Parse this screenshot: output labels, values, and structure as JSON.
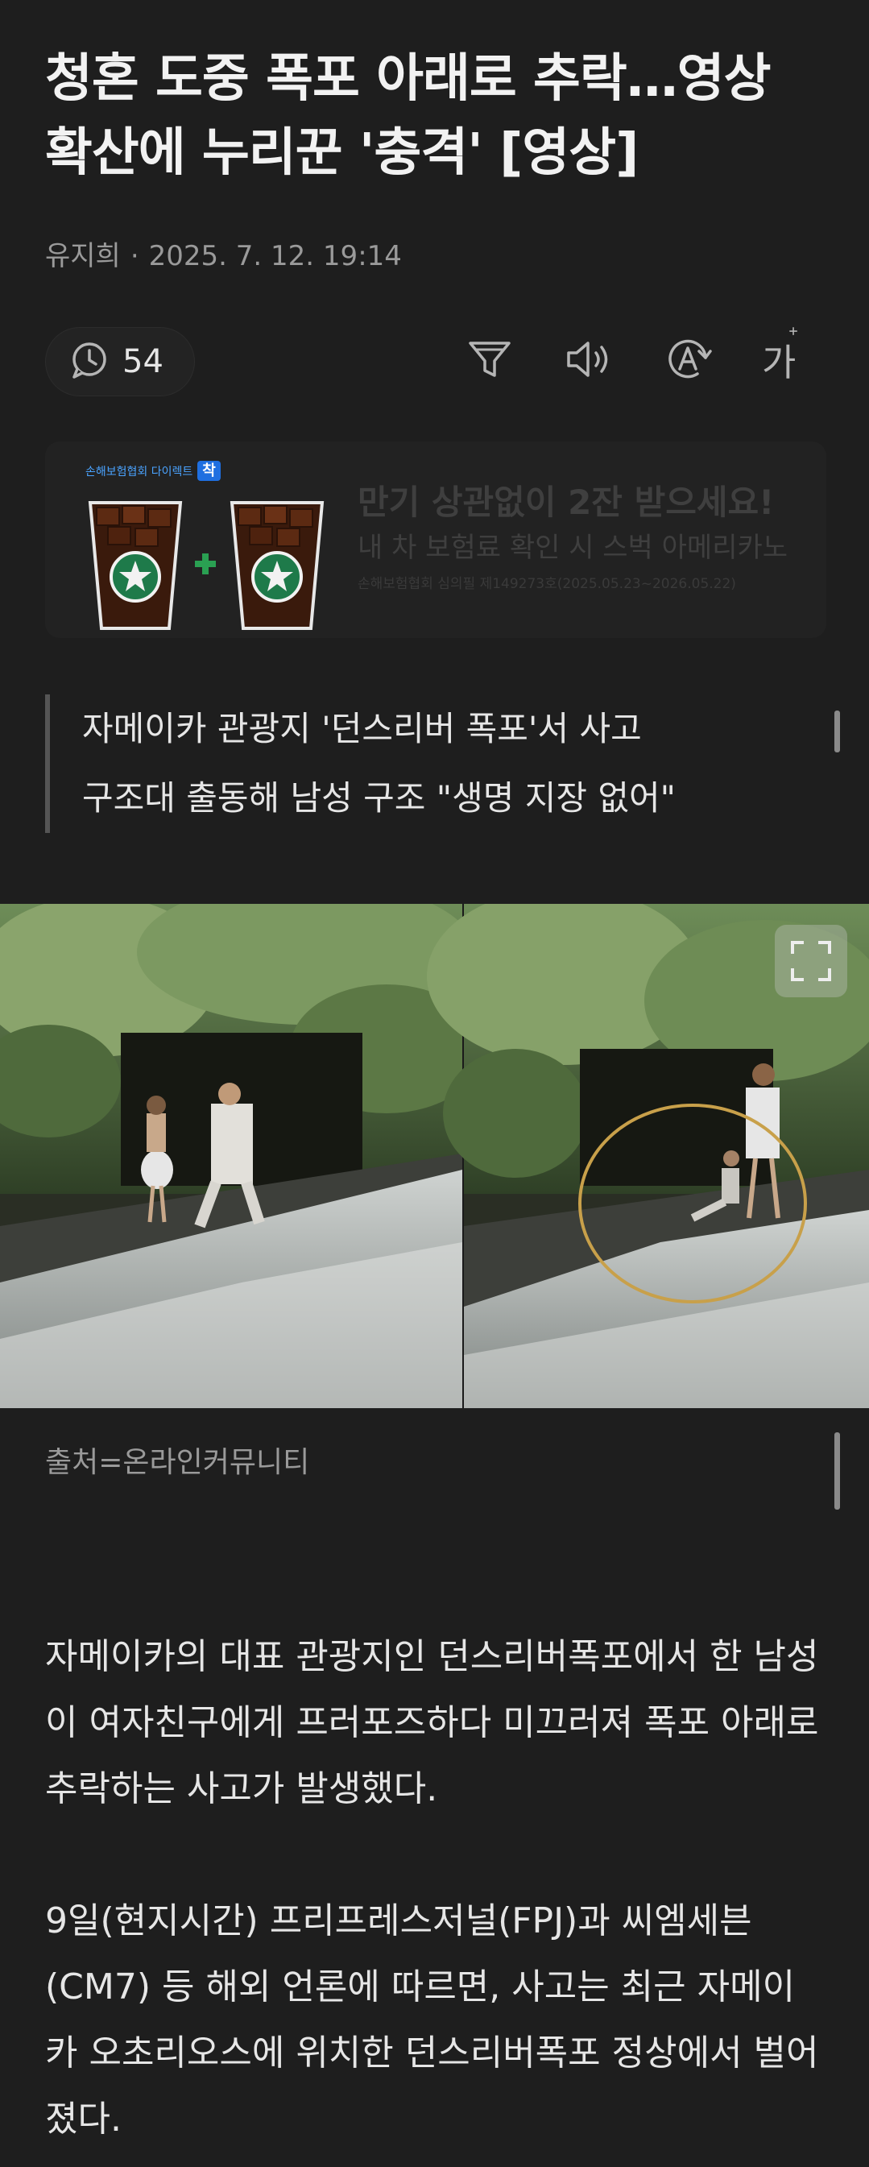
{
  "article": {
    "headline": "청혼 도중 폭포 아래로 추락…영상 확산에 누리꾼 '충격' [영상]",
    "author": "유지희",
    "separator": "·",
    "datetime": "2025. 7. 12. 19:14"
  },
  "toolbar": {
    "comment_count": "54",
    "icons": [
      "comment-clock-icon",
      "filter-icon",
      "speaker-icon",
      "translate-icon",
      "font-size-icon"
    ],
    "font_size_label": "가"
  },
  "ad": {
    "badge_text": "손해보험협회 다이렉트",
    "badge_mark": "착",
    "headline": "만기 상관없이 2잔 받으세요!",
    "subtext": "내 차 보험료 확인 시 스벅 아메리카노",
    "notice": "손해보험협회 심의필 제149273호(2025.05.23~2026.05.22)"
  },
  "summary": {
    "lines": [
      "자메이카 관광지 '던스리버 폭포'서 사고",
      "구조대 출동해 남성 구조 \"생명 지장 없어\""
    ]
  },
  "photo": {
    "caption": "출처=온라인커뮤니티"
  },
  "body": {
    "paragraphs": [
      "자메이카의 대표 관광지인 던스리버폭포에서 한 남성이 여자친구에게 프러포즈하다 미끄러져 폭포 아래로 추락하는 사고가 발생했다.",
      "9일(현지시간) 프리프레스저널(FPJ)과 씨엠세븐(CM7) 등 해외 언론에 따르면, 사고는 최근 자메이카 오초리오스에 위치한 던스리버폭포 정상에서 벌어졌다."
    ]
  },
  "colors": {
    "background": "#1e1e1e",
    "text": "#e6e6e6",
    "muted": "#9a9a9a",
    "highlight_circle": "#c8a04a"
  }
}
